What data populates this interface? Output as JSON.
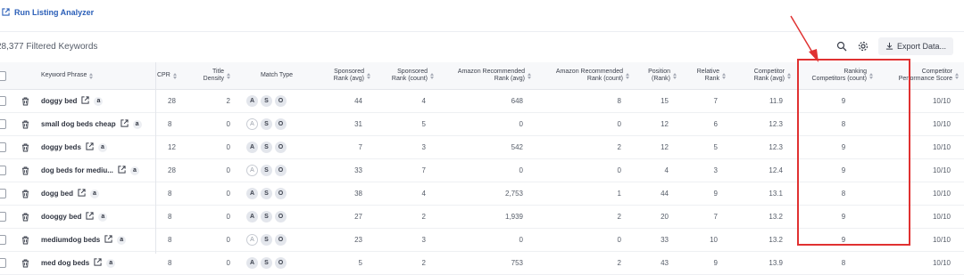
{
  "top_link": {
    "label": "Run Listing Analyzer"
  },
  "summary": {
    "filtered_text": "28,377 Filtered Keywords"
  },
  "toolbar": {
    "export_label": "Export Data..."
  },
  "table": {
    "headers": {
      "keyword": "Keyword Phrase",
      "cpr": "CPR",
      "title_density": [
        "Title",
        "Density"
      ],
      "match_type": "Match Type",
      "sponsored_avg": [
        "Sponsored",
        "Rank (avg)"
      ],
      "sponsored_count": [
        "Sponsored",
        "Rank (count)"
      ],
      "amz_rec_avg": [
        "Amazon Recommended",
        "Rank (avg)"
      ],
      "amz_rec_count": [
        "Amazon Recommended",
        "Rank (count)"
      ],
      "position": [
        "Position",
        "(Rank)"
      ],
      "relative": [
        "Relative",
        "Rank"
      ],
      "competitor_avg": [
        "Competitor",
        "Rank (avg)"
      ],
      "ranking_competitors": [
        "Ranking",
        "Competitors (count)"
      ],
      "competitor_perf": [
        "Competitor",
        "Performance Score"
      ]
    },
    "match_letters": [
      "A",
      "S",
      "O"
    ],
    "amazon_badge": "a",
    "rows": [
      {
        "keyword": "doggy bed",
        "cpr": "28",
        "title_density": "2",
        "match": [
          true,
          true,
          true
        ],
        "sponsored_avg": "44",
        "sponsored_count": "4",
        "amz_rec_avg": "648",
        "amz_rec_count": "8",
        "position": "15",
        "relative": "7",
        "competitor_avg": "11.9",
        "ranking_competitors": "9",
        "competitor_perf": "10/10"
      },
      {
        "keyword": "small dog beds cheap",
        "cpr": "8",
        "title_density": "0",
        "match": [
          false,
          true,
          true
        ],
        "sponsored_avg": "31",
        "sponsored_count": "5",
        "amz_rec_avg": "0",
        "amz_rec_count": "0",
        "position": "12",
        "relative": "6",
        "competitor_avg": "12.3",
        "ranking_competitors": "8",
        "competitor_perf": "10/10"
      },
      {
        "keyword": "doggy beds",
        "cpr": "12",
        "title_density": "0",
        "match": [
          true,
          true,
          true
        ],
        "sponsored_avg": "7",
        "sponsored_count": "3",
        "amz_rec_avg": "542",
        "amz_rec_count": "2",
        "position": "12",
        "relative": "5",
        "competitor_avg": "12.3",
        "ranking_competitors": "9",
        "competitor_perf": "10/10"
      },
      {
        "keyword": "dog beds for mediu...",
        "cpr": "28",
        "title_density": "0",
        "match": [
          false,
          true,
          true
        ],
        "sponsored_avg": "33",
        "sponsored_count": "7",
        "amz_rec_avg": "0",
        "amz_rec_count": "0",
        "position": "4",
        "relative": "3",
        "competitor_avg": "12.4",
        "ranking_competitors": "9",
        "competitor_perf": "10/10"
      },
      {
        "keyword": "dogg bed",
        "cpr": "8",
        "title_density": "0",
        "match": [
          true,
          true,
          true
        ],
        "sponsored_avg": "38",
        "sponsored_count": "4",
        "amz_rec_avg": "2,753",
        "amz_rec_count": "1",
        "position": "44",
        "relative": "9",
        "competitor_avg": "13.1",
        "ranking_competitors": "8",
        "competitor_perf": "10/10"
      },
      {
        "keyword": "dooggy bed",
        "cpr": "8",
        "title_density": "0",
        "match": [
          true,
          true,
          true
        ],
        "sponsored_avg": "27",
        "sponsored_count": "2",
        "amz_rec_avg": "1,939",
        "amz_rec_count": "2",
        "position": "20",
        "relative": "7",
        "competitor_avg": "13.2",
        "ranking_competitors": "9",
        "competitor_perf": "10/10"
      },
      {
        "keyword": "mediumdog beds",
        "cpr": "8",
        "title_density": "0",
        "match": [
          false,
          true,
          true
        ],
        "sponsored_avg": "23",
        "sponsored_count": "3",
        "amz_rec_avg": "0",
        "amz_rec_count": "0",
        "position": "33",
        "relative": "10",
        "competitor_avg": "13.2",
        "ranking_competitors": "9",
        "competitor_perf": "10/10"
      },
      {
        "keyword": "med dog beds",
        "cpr": "8",
        "title_density": "0",
        "match": [
          true,
          true,
          true
        ],
        "sponsored_avg": "5",
        "sponsored_count": "2",
        "amz_rec_avg": "753",
        "amz_rec_count": "2",
        "position": "43",
        "relative": "9",
        "competitor_avg": "13.9",
        "ranking_competitors": "8",
        "competitor_perf": "10/10"
      }
    ]
  },
  "annotation": {
    "highlight_color": "#e03131",
    "link_color": "#2b5fb8"
  }
}
